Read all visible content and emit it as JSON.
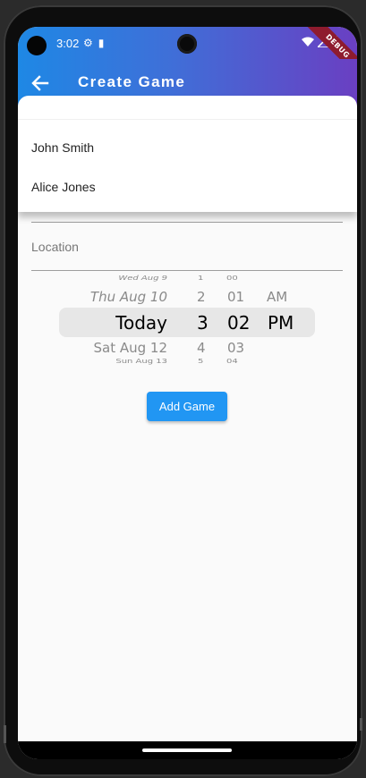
{
  "status": {
    "time": "3:02",
    "debug": "DEBUG"
  },
  "appbar": {
    "title": "Create Game"
  },
  "dropdown": {
    "items": [
      "John Smith",
      "Alice Jones"
    ]
  },
  "form": {
    "location_label": "Location"
  },
  "picker": {
    "date_col": [
      "Wed Aug 9",
      "Thu Aug 10",
      "Today",
      "Sat Aug 12",
      "Sun Aug 13"
    ],
    "hour_col": [
      "1",
      "2",
      "3",
      "4",
      "5"
    ],
    "minute_col": [
      "00",
      "01",
      "02",
      "03",
      "04"
    ],
    "ampm_col": [
      "AM",
      "PM"
    ]
  },
  "actions": {
    "add_game": "Add Game"
  },
  "colors": {
    "button": "#2196f3",
    "debug": "#8e1b2e",
    "gradient_start": "#1e88e5",
    "gradient_end": "#6a3fc2"
  }
}
